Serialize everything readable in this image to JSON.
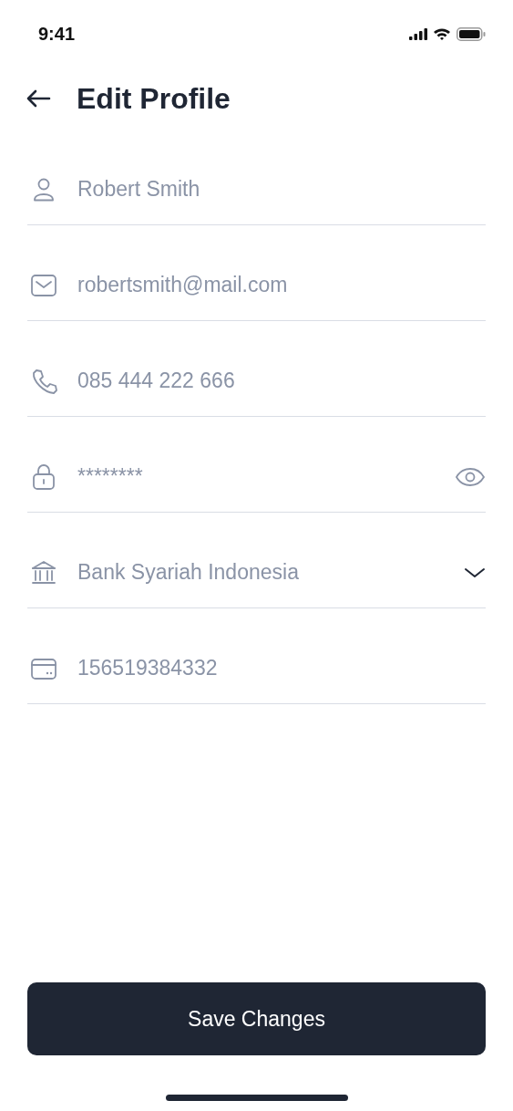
{
  "status_bar": {
    "time": "9:41"
  },
  "header": {
    "title": "Edit Profile"
  },
  "fields": [
    {
      "kind": "text",
      "value": "Robert Smith"
    },
    {
      "kind": "text",
      "value": "robertsmith@mail.com"
    },
    {
      "kind": "text",
      "value": "085 444 222 666"
    },
    {
      "kind": "password",
      "value": "********"
    },
    {
      "kind": "select",
      "value": "Bank Syariah Indonesia"
    },
    {
      "kind": "text",
      "value": "156519384332"
    }
  ],
  "save_button": {
    "label": "Save Changes"
  }
}
